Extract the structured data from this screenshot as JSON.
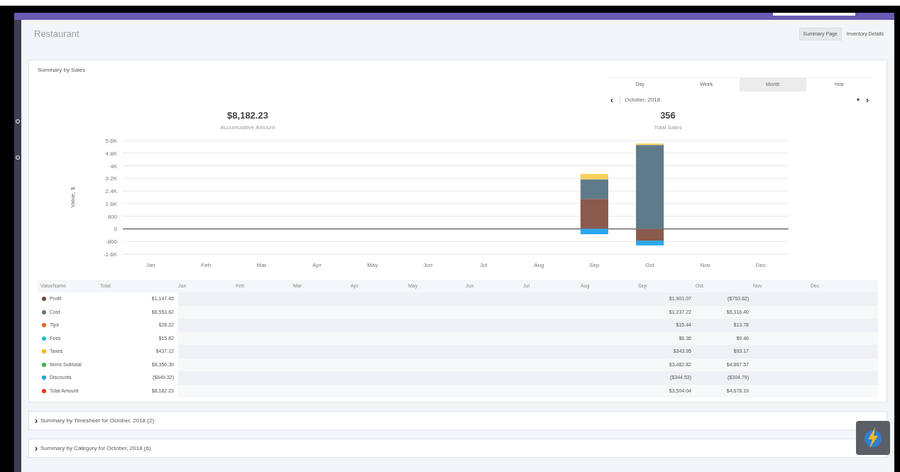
{
  "page": {
    "title": "Restaurant"
  },
  "page_tabs": [
    {
      "label": "Summary Page",
      "selected": true
    },
    {
      "label": "Inventory Details",
      "selected": false
    }
  ],
  "sales_card": {
    "title": "Summary by Sales",
    "period_tabs": [
      {
        "label": "Day",
        "selected": false
      },
      {
        "label": "Week",
        "selected": false
      },
      {
        "label": "Month",
        "selected": true
      },
      {
        "label": "Year",
        "selected": false
      }
    ],
    "prev": "‹",
    "next": "›",
    "date": "October, 2018",
    "dropdown": "▾",
    "stats": [
      {
        "value": "$8,182.23",
        "label": "Accumulative Amount"
      },
      {
        "value": "356",
        "label": "Total Sales"
      }
    ],
    "chart_data": {
      "type": "bar",
      "stacked": true,
      "grid": true,
      "ylabel": "Value, $",
      "categories": [
        "Jan",
        "Feb",
        "Mar",
        "Apr",
        "May",
        "Jun",
        "Jul",
        "Aug",
        "Sep",
        "Oct",
        "Nov",
        "Dec"
      ],
      "ylim": [
        -1600,
        5600
      ],
      "yticks": [
        {
          "value": -1600,
          "label": "-1.6K"
        },
        {
          "value": -800,
          "label": "-800"
        },
        {
          "value": 0,
          "label": "0"
        },
        {
          "value": 800,
          "label": "800"
        },
        {
          "value": 1600,
          "label": "1.6K"
        },
        {
          "value": 2400,
          "label": "2.4K"
        },
        {
          "value": 3200,
          "label": "3.2K"
        },
        {
          "value": 4000,
          "label": "4K"
        },
        {
          "value": 4800,
          "label": "4.8K"
        },
        {
          "value": 5600,
          "label": "5.6K"
        }
      ],
      "series": [
        {
          "color": "#8a5a4c",
          "values": [
            null,
            null,
            null,
            null,
            null,
            null,
            null,
            null,
            1900,
            -750,
            null,
            null
          ]
        },
        {
          "color": "#5f7b89",
          "values": [
            null,
            null,
            null,
            null,
            null,
            null,
            null,
            null,
            1240,
            5320,
            null,
            null
          ]
        },
        {
          "color": "#f6d05a",
          "values": [
            null,
            null,
            null,
            null,
            null,
            null,
            null,
            null,
            340,
            90,
            null,
            null
          ]
        },
        {
          "color": "#2aa8ee",
          "values": [
            null,
            null,
            null,
            null,
            null,
            null,
            null,
            null,
            -340,
            -300,
            null,
            null
          ]
        }
      ]
    },
    "table": {
      "name_header": "ValueName",
      "total_header": "Total",
      "rows": [
        {
          "name": "Profit",
          "color": "#6b4a44",
          "total": "$1,147.45"
        },
        {
          "name": "Cost",
          "color": "#5f7480",
          "total": "$6,553.62"
        },
        {
          "name": "Tips",
          "color": "#e0661a",
          "total": "$28.22"
        },
        {
          "name": "Fees",
          "color": "#22c3d0",
          "total": "$15.82"
        },
        {
          "name": "Taxes",
          "color": "#f5b800",
          "total": "$437.12"
        },
        {
          "name": "Items Subtotal",
          "color": "#3bb04a",
          "total": "$8,350.39"
        },
        {
          "name": "Discounts",
          "color": "#1ea0e8",
          "total": "($649.32)"
        },
        {
          "name": "Total Amount",
          "color": "#e8321c",
          "total": "$8,182.23"
        }
      ],
      "month_columns": [
        {
          "header": "Jan"
        },
        {
          "header": "Feb"
        },
        {
          "header": "Mar"
        },
        {
          "header": "Apr"
        },
        {
          "header": "May"
        },
        {
          "header": "Jun"
        },
        {
          "header": "Jul"
        },
        {
          "header": "Aug"
        },
        {
          "header": "Sep",
          "values": [
            "$1,901.07",
            "$1,237.22",
            "$15.44",
            "$6.36",
            "$343.95",
            "$3,482.82",
            "($344.53)",
            "$3,504.04"
          ]
        },
        {
          "header": "Oct",
          "values": [
            "($753.62)",
            "$5,316.40",
            "$13.78",
            "$9.46",
            "$93.17",
            "$4,867.57",
            "($304.79)",
            "$4,678.19"
          ]
        },
        {
          "header": "Nov"
        },
        {
          "header": "Dec"
        }
      ]
    }
  },
  "sections": [
    {
      "title": "Summary by Timesheet for October, 2018 (2)",
      "expanded": false,
      "caret": "›"
    },
    {
      "title": "Summary by Category for October, 2018 (6)",
      "expanded": false,
      "caret": "›"
    }
  ]
}
